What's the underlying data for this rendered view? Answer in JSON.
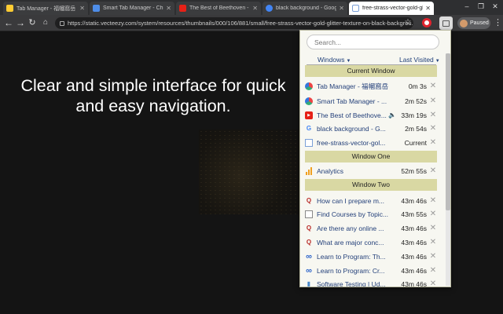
{
  "browser": {
    "tabs": [
      {
        "title": "Tab Manager - 福幗窩岳 - C",
        "fav_color": "#ffcc33",
        "active": false
      },
      {
        "title": "Smart Tab Manager - Chrome",
        "fav_color": "#4e8de8",
        "active": false
      },
      {
        "title": "The Best of Beethoven - Y",
        "fav_color": "#e62117",
        "active": false
      },
      {
        "title": "black background - Google S",
        "fav_color": "#4285f4",
        "active": false
      },
      {
        "title": "free-strass-vector-gold-glitt",
        "fav_color": "#7aa0d8",
        "active": true
      }
    ],
    "address_bar": {
      "url": "https://static.vecteezy.com/system/resources/thumbnails/000/106/881/small/free-strass-vector-gold-glitter-texture-on-black-backgrou..."
    },
    "profile": {
      "label": "Paused"
    }
  },
  "page": {
    "headline": "Clear and simple interface for quick and easy navigation."
  },
  "popup": {
    "search": {
      "placeholder": "Search..."
    },
    "windows_dropdown": "Windows",
    "sort_dropdown": "Last Visited",
    "groups": [
      {
        "title": "Current Window",
        "items": [
          {
            "title": "Tab Manager - 福幗窩岳",
            "time": "0m 3s",
            "icon": "tab-manager-icon",
            "audio": false
          },
          {
            "title": "Smart Tab Manager - ...",
            "time": "2m 52s",
            "icon": "tab-manager-icon",
            "audio": false
          },
          {
            "title": "The Best of Beethove...",
            "time": "33m 19s",
            "icon": "youtube-icon",
            "audio": true
          },
          {
            "title": "black background - G...",
            "time": "2m 54s",
            "icon": "google-icon",
            "audio": false
          },
          {
            "title": "free-strass-vector-gol...",
            "time": "Current",
            "icon": "image-icon",
            "audio": false
          }
        ]
      },
      {
        "title": "Window One",
        "items": [
          {
            "title": "Analytics",
            "time": "52m 55s",
            "icon": "analytics-icon",
            "audio": false
          }
        ]
      },
      {
        "title": "Window Two",
        "items": [
          {
            "title": "How can I prepare m...",
            "time": "43m 46s",
            "icon": "quora-icon",
            "audio": false
          },
          {
            "title": "Find Courses by Topic...",
            "time": "43m 55s",
            "icon": "udemy-icon",
            "audio": false
          },
          {
            "title": "Are there any online ...",
            "time": "43m 46s",
            "icon": "quora-icon",
            "audio": false
          },
          {
            "title": "What are major conc...",
            "time": "43m 46s",
            "icon": "quora-icon",
            "audio": false
          },
          {
            "title": "Learn to Program: Th...",
            "time": "43m 46s",
            "icon": "coursera-icon",
            "audio": false
          },
          {
            "title": "Learn to Program: Cr...",
            "time": "43m 46s",
            "icon": "coursera-icon",
            "audio": false
          },
          {
            "title": "Software Testing | Ud...",
            "time": "43m 46s",
            "icon": "software-testing-icon",
            "audio": false
          }
        ]
      }
    ]
  }
}
